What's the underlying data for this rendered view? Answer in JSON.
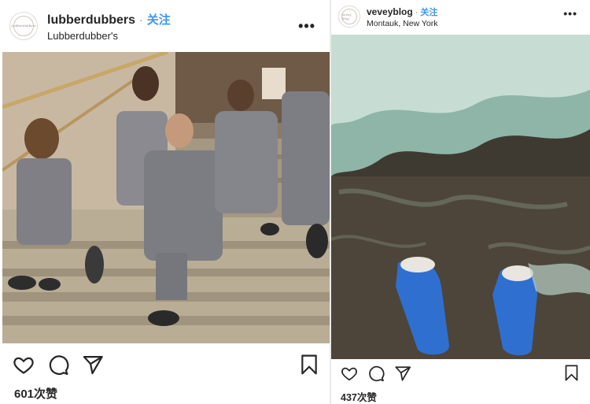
{
  "posts": [
    {
      "username": "lubberdubbers",
      "separator": "·",
      "follow_label": "关注",
      "subtitle": "Lubberdubber's",
      "avatar_text": "Lubberdubbers",
      "more_label": "•••",
      "likes": "601次赞",
      "photo_icon": "group-on-stairs-photo"
    },
    {
      "username": "veveyblog",
      "separator": "·",
      "follow_label": "关注",
      "subtitle": "Montauk, New York",
      "avatar_text": "vevey blog",
      "more_label": "•••",
      "likes": "437次赞",
      "photo_icon": "shoes-in-surf-photo"
    }
  ],
  "icons": {
    "like": "heart-icon",
    "comment": "comment-icon",
    "share": "share-icon",
    "save": "bookmark-icon"
  },
  "colors": {
    "follow": "#3897f0",
    "text": "#262626",
    "background": "#ffffff"
  }
}
